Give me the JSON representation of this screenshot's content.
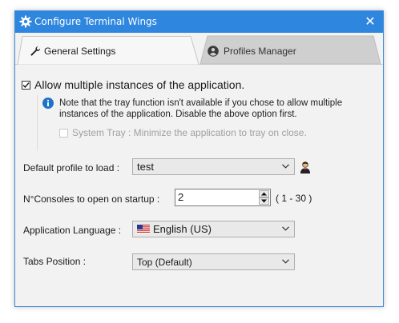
{
  "window": {
    "title": "Configure Terminal Wings",
    "close_glyph": "✕"
  },
  "tabs": [
    {
      "label": "General Settings",
      "icon": "wrench-icon",
      "active": true
    },
    {
      "label": "Profiles Manager",
      "icon": "user-circle-icon",
      "active": false
    }
  ],
  "general": {
    "multi_instances": {
      "label": "Allow multiple instances of the application.",
      "checked": true
    },
    "info_note": "Note that the tray function isn't available if you chose to allow multiple instances of the application. Disable the above option first.",
    "info_line1": "Note that the tray function isn't available if you chose to allow multiple",
    "info_line2": "instances of the application. Disable the above option first.",
    "system_tray": {
      "label": "System Tray : Minimize the application to tray on close.",
      "checked": false,
      "enabled": false
    },
    "default_profile": {
      "label": "Default profile to load :",
      "value": "test"
    },
    "consoles": {
      "label": "N°Consoles to open on startup :",
      "value": "2",
      "range": "( 1 - 30 )"
    },
    "language": {
      "label": "Application Language :",
      "value": "English (US)",
      "flag": "us-flag-icon"
    },
    "tabs_position": {
      "label": "Tabs Position :",
      "value": "Top (Default)"
    }
  },
  "colors": {
    "titlebar": "#2e86de",
    "info_icon": "#1e73c8"
  }
}
